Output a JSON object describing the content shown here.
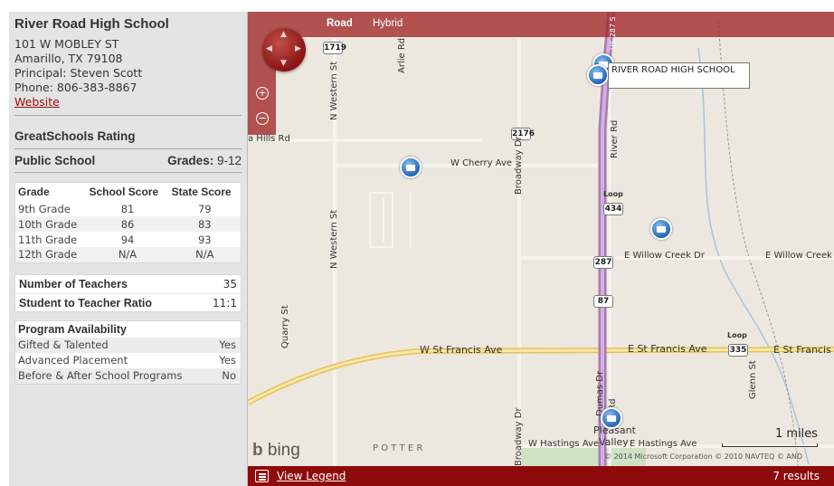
{
  "school": {
    "name": "River Road High School",
    "street": "101 W MOBLEY ST",
    "city": "Amarillo, TX 79108",
    "principal": "Principal: Steven Scott",
    "phone": "Phone: 806-383-8867",
    "website_label": "Website"
  },
  "rating": {
    "heading": "GreatSchools Rating",
    "school_type": "Public School",
    "grades_label": "Grades:",
    "grades_value": "9-12"
  },
  "scores": {
    "headers": [
      "Grade",
      "School Score",
      "State Score"
    ],
    "rows": [
      [
        "9th Grade",
        "81",
        "79"
      ],
      [
        "10th Grade",
        "86",
        "83"
      ],
      [
        "11th Grade",
        "94",
        "93"
      ],
      [
        "12th Grade",
        "N/A",
        "N/A"
      ]
    ]
  },
  "teachers": {
    "num_label": "Number of Teachers",
    "num_value": "35",
    "ratio_label": "Student to Teacher Ratio",
    "ratio_value": "11:1"
  },
  "programs": {
    "heading": "Program Availability",
    "rows": [
      [
        "Gifted & Talented",
        "Yes"
      ],
      [
        "Advanced Placement",
        "Yes"
      ],
      [
        "Before & After School Programs",
        "No"
      ]
    ]
  },
  "map": {
    "tab_road": "Road",
    "tab_hybrid": "Hybrid",
    "tooltip": "RIVER ROAD HIGH SCHOOL",
    "brand": "bing",
    "scale_label": "1 miles",
    "copyright": "© 2014 Microsoft Corporation   © 2010 NAVTEQ   © AND",
    "legend_label": "View Legend",
    "results": "7 results",
    "labels": {
      "l1719": "1719",
      "l2176": "2176",
      "l434": "434",
      "l287": "287",
      "l87": "87",
      "l335": "335",
      "loop1": "Loop",
      "loop2": "Loop",
      "hills": "a Hills Rd",
      "cherry": "W Cherry Ave",
      "willow_e": "E Willow Creek Dr",
      "willow_e2": "E Willow Creek",
      "francis_w": "W St Francis Ave",
      "francis_e": "E St Francis Ave",
      "francis_e2": "E St Francis",
      "hastings_w": "W Hastings Ave",
      "hastings_e": "E Hastings Ave",
      "pleasant": "Pleasant",
      "valley": "Valley",
      "potter": "P  O  T  T  E  R",
      "western1": "N Western St",
      "western2": "N Western St",
      "arlie": "Arlie Rd",
      "broadway": "Broadway Dr",
      "broadway2": "Broadway Dr",
      "river": "River Rd",
      "river2": "ver Rd",
      "dumas": "Dumas Dr",
      "quarry": "Quarry St",
      "glenn": "Glenn St",
      "us": "US-287 S"
    }
  }
}
